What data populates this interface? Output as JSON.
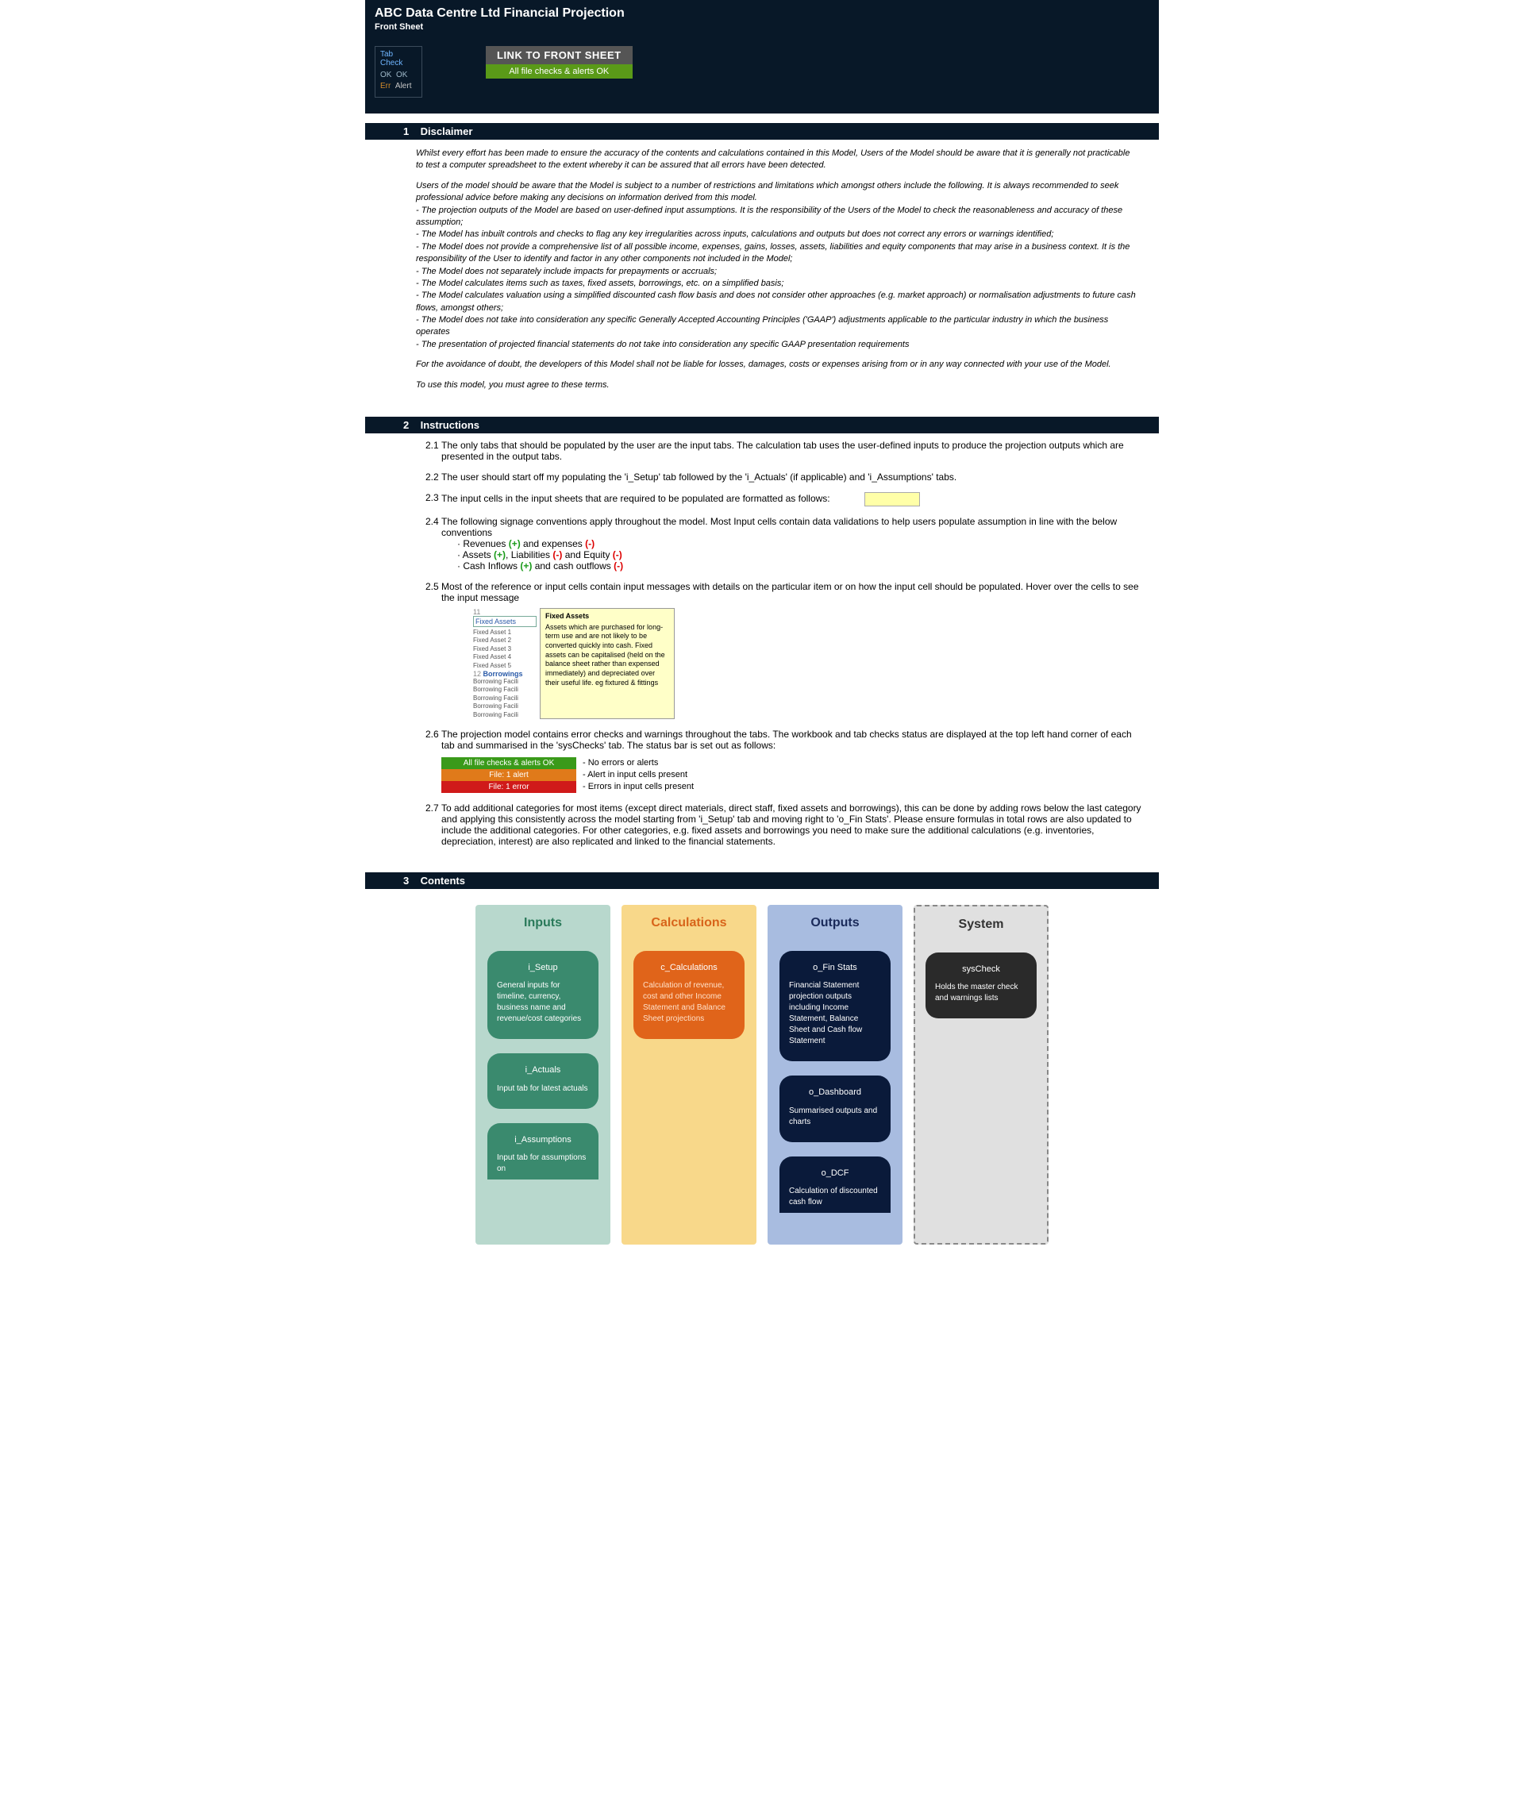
{
  "header": {
    "title": "ABC Data Centre Ltd Financial Projection",
    "subtitle": "Front Sheet"
  },
  "tabCheck": {
    "label": "Tab Check",
    "row1a": "OK",
    "row1b": "OK",
    "row2a": "Err",
    "row2b": "Alert"
  },
  "linkBox": {
    "line1": "LINK TO FRONT SHEET",
    "line2": "All file checks & alerts OK"
  },
  "sections": {
    "s1": {
      "num": "1",
      "title": "Disclaimer"
    },
    "s2": {
      "num": "2",
      "title": "Instructions"
    },
    "s3": {
      "num": "3",
      "title": "Contents"
    }
  },
  "disclaimer": {
    "p1": "Whilst every effort has been made to ensure the accuracy of the contents and calculations contained in this Model, Users of the Model should be aware that it is generally not practicable to test a computer spreadsheet to the extent whereby it can be assured that all errors have been detected.",
    "p2": "Users of the model should be aware that the Model is subject to a number of restrictions and limitations which amongst others include the following. It is always recommended to seek professional advice before making any decisions on information derived from this model.",
    "b1": "- The projection outputs of the Model are based on user-defined input assumptions. It is the responsibility of the Users of the Model to check the reasonableness and accuracy of these assumption;",
    "b2": "- The Model has inbuilt controls and checks to flag any key irregularities across inputs, calculations and outputs but does not correct any errors or warnings identified;",
    "b3": "- The Model does not provide a comprehensive list of all possible income, expenses, gains, losses, assets, liabilities and equity components that may arise in a business context. It is the responsibility of the User to identify and factor in any other components not included in the Model;",
    "b4": "- The Model does not separately include impacts for prepayments or accruals;",
    "b5": "- The Model calculates items such as taxes, fixed assets, borrowings, etc. on a simplified basis;",
    "b6": "- The Model calculates valuation using a simplified discounted cash flow basis and does not consider other approaches (e.g. market approach) or normalisation adjustments to future cash flows, amongst others;",
    "b7": "- The Model does not take into consideration any specific Generally Accepted Accounting Principles ('GAAP') adjustments applicable to the particular industry in which the business operates",
    "b8": "- The presentation of projected financial statements do not take into consideration any specific GAAP presentation requirements",
    "p3": "For the avoidance of doubt, the developers of this Model shall not be liable for losses, damages, costs or expenses arising from or in any way connected with your use of the Model.",
    "p4": "To use this model, you must agree to these terms."
  },
  "instructions": {
    "i21": {
      "num": "2.1",
      "text": "The only tabs that should be populated by the user are the input tabs. The calculation tab uses the user-defined inputs to produce the projection outputs which are presented in the output tabs."
    },
    "i22": {
      "num": "2.2",
      "text": "The user should start off my populating the 'i_Setup' tab followed by the 'i_Actuals' (if applicable) and 'i_Assumptions' tabs."
    },
    "i23": {
      "num": "2.3",
      "text": "The input cells in the input sheets that are required to be populated are formatted as follows:"
    },
    "i24": {
      "num": "2.4",
      "text": "The following signage conventions apply throughout the model. Most Input cells contain data validations to help users populate assumption in line with the below conventions",
      "l1a": "Revenues ",
      "l1b": "(+)",
      "l1c": " and expenses ",
      "l1d": "(-)",
      "l2a": "Assets ",
      "l2b": "(+)",
      "l2c": ", Liabilities ",
      "l2d": "(-)",
      "l2e": " and Equity ",
      "l2f": "(-)",
      "l3a": "Cash Inflows ",
      "l3b": "(+)",
      "l3c": " and cash outflows ",
      "l3d": "(-)"
    },
    "i25": {
      "num": "2.5",
      "text": "Most of the reference or input cells contain input messages with details on the particular item or on how the input cell should be populated. Hover over the cells to see the input message",
      "demo": {
        "n11": "11",
        "hdr": "Fixed Assets",
        "fa1": "Fixed Asset 1",
        "fa2": "Fixed Asset 2",
        "fa3": "Fixed Asset 3",
        "fa4": "Fixed Asset 4",
        "fa5": "Fixed Asset 5",
        "n12": "12",
        "borrow": "Borrowings",
        "bf1": "Borrowing Facili",
        "bf2": "Borrowing Facili",
        "bf3": "Borrowing Facili",
        "bf4": "Borrowing Facili",
        "bf5": "Borrowing Facili",
        "tipTitle": "Fixed Assets",
        "tipBody": "Assets which are purchased for long-term use and are not likely to be converted quickly into cash. Fixed assets can be capitalised (held on the balance sheet rather than expensed immediately) and depreciated over their useful life. eg fixtured & fittings"
      }
    },
    "i26": {
      "num": "2.6",
      "text": "The projection model contains error checks and warnings throughout the tabs. The workbook and tab checks status are displayed at the top left hand corner of each tab and summarised in the 'sysChecks' tab. The status bar is set out as follows:",
      "green": "All file checks & alerts OK",
      "greenLbl": "- No errors or alerts",
      "orange": "File: 1 alert",
      "orangeLbl": "- Alert in input cells present",
      "red": "File: 1 error",
      "redLbl": "- Errors in input cells present"
    },
    "i27": {
      "num": "2.7",
      "text": "To add additional categories for most items (except direct materials, direct staff, fixed assets and borrowings), this can be done by adding rows below the last category and applying this consistently across the model starting from 'i_Setup' tab and moving right to 'o_Fin Stats'. Please ensure formulas in total rows are also updated to include the additional categories. For other categories, e.g. fixed assets and borrowings you need to make sure the additional calculations (e.g. inventories, depreciation, interest) are also replicated and linked to the financial statements."
    }
  },
  "contents": {
    "inputs": {
      "title": "Inputs",
      "c1": {
        "title": "i_Setup",
        "desc": "General inputs for timeline, currency, business name and revenue/cost categories"
      },
      "c2": {
        "title": "i_Actuals",
        "desc": "Input tab for latest actuals"
      },
      "c3": {
        "title": "i_Assumptions",
        "desc": "Input tab for assumptions on"
      }
    },
    "calcs": {
      "title": "Calculations",
      "c1": {
        "title": "c_Calculations",
        "desc": "Calculation of revenue, cost and other Income Statement and Balance Sheet projections"
      }
    },
    "outputs": {
      "title": "Outputs",
      "c1": {
        "title": "o_Fin Stats",
        "desc": "Financial Statement projection outputs including Income Statement, Balance Sheet and Cash flow Statement"
      },
      "c2": {
        "title": "o_Dashboard",
        "desc": "Summarised outputs and charts"
      },
      "c3": {
        "title": "o_DCF",
        "desc": "Calculation of discounted cash flow"
      }
    },
    "system": {
      "title": "System",
      "c1": {
        "title": "sysCheck",
        "desc": "Holds the master check and warnings lists"
      }
    }
  }
}
